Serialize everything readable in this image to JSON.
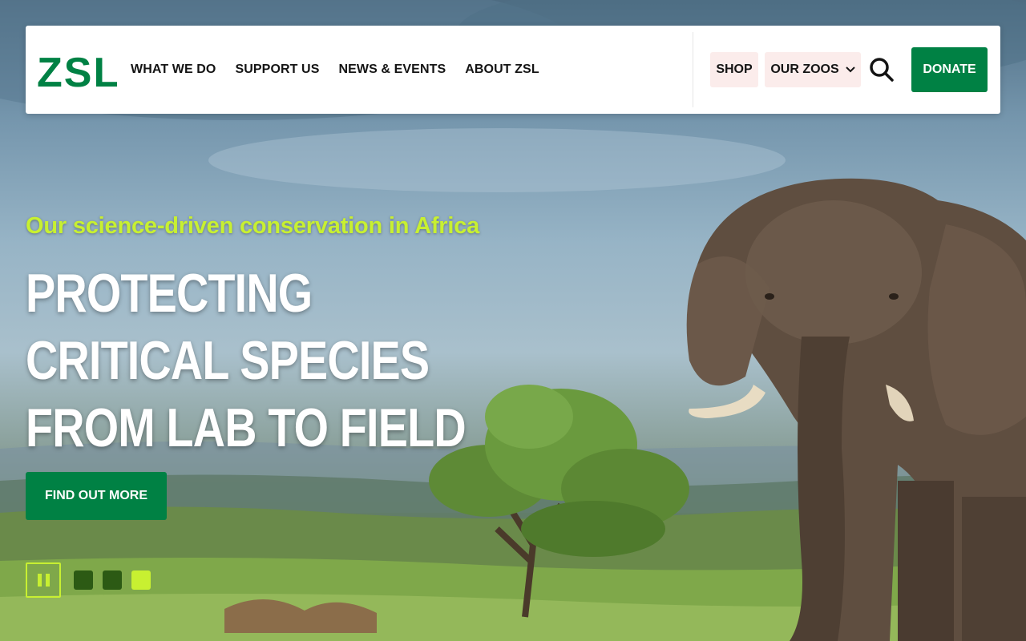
{
  "logo": {
    "text": "ZSL",
    "color": "#008144"
  },
  "nav": {
    "main_links": [
      {
        "label": "WHAT WE DO"
      },
      {
        "label": "SUPPORT US"
      },
      {
        "label": "NEWS & EVENTS"
      },
      {
        "label": "ABOUT ZSL"
      }
    ],
    "shop_label": "SHOP",
    "zoos_label": "OUR ZOOS",
    "search_icon": "search-icon",
    "donate_label": "DONATE"
  },
  "hero": {
    "kicker": "Our science-driven conservation in Africa",
    "headline_lines": [
      "PROTECTING",
      "CRITICAL SPECIES",
      "FROM LAB TO FIELD"
    ],
    "cta_label": "FIND OUT MORE"
  },
  "carousel": {
    "slide_count": 3,
    "active_slide": 3,
    "pause_icon": "pause-icon"
  },
  "colors": {
    "brand_green": "#008144",
    "accent_lime": "#c8f031",
    "pill_bg": "#fbeceb"
  }
}
